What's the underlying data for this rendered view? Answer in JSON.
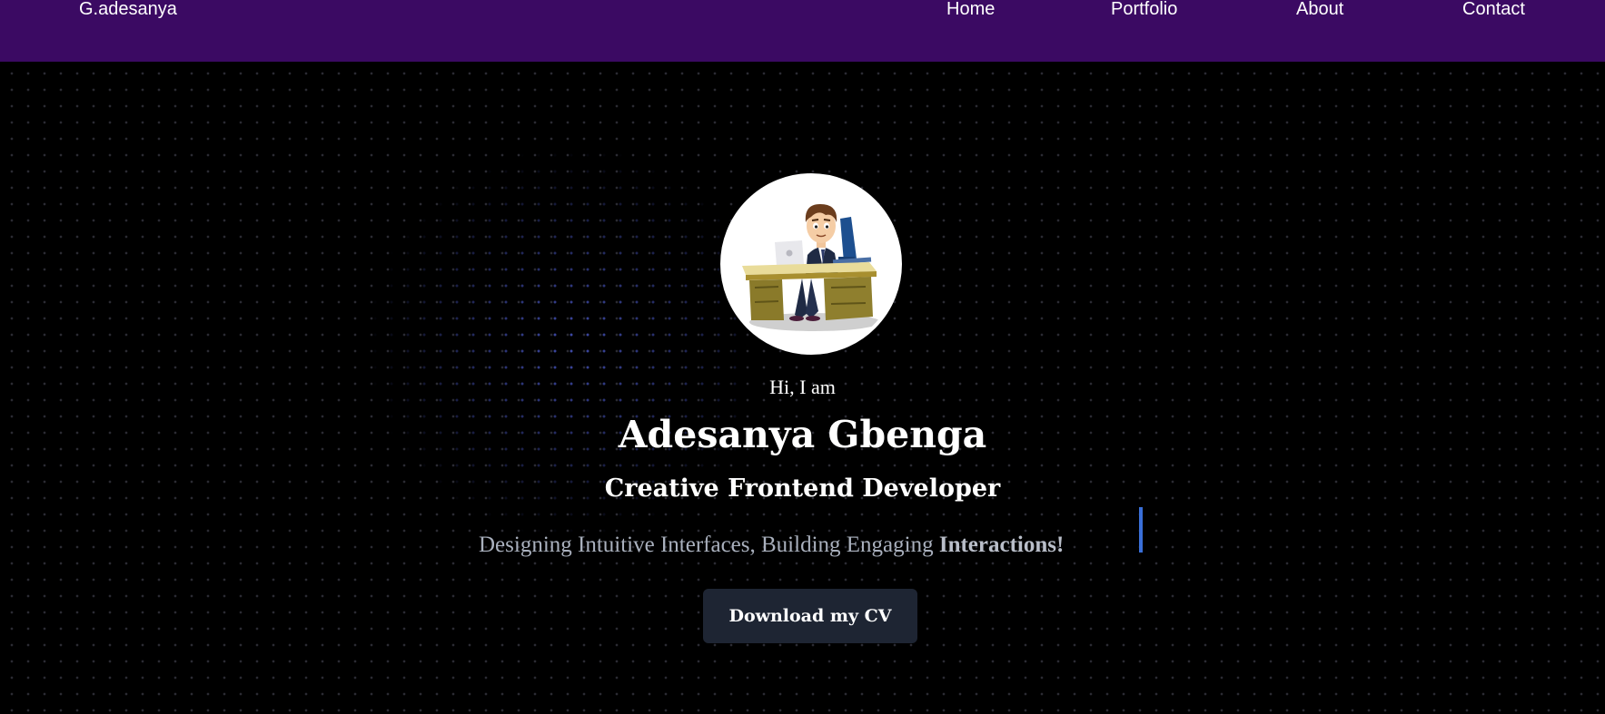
{
  "navbar": {
    "brand": "G.adesanya",
    "links": [
      {
        "label": "Home"
      },
      {
        "label": "Portfolio"
      },
      {
        "label": "About"
      },
      {
        "label": "Contact"
      }
    ]
  },
  "hero": {
    "greeting": "Hi, I am",
    "name": "Adesanya Gbenga",
    "role": "Creative Frontend Developer",
    "tagline_prefix": "Designing Intuitive Interfaces, Building Engaging",
    "tagline_highlight": "Interactions!",
    "cta_label": "Download my CV"
  },
  "colors": {
    "navbar_bg": "#3b0a63",
    "page_bg": "#000000",
    "button_bg": "#1e2533",
    "caret": "#3a6fd8"
  }
}
